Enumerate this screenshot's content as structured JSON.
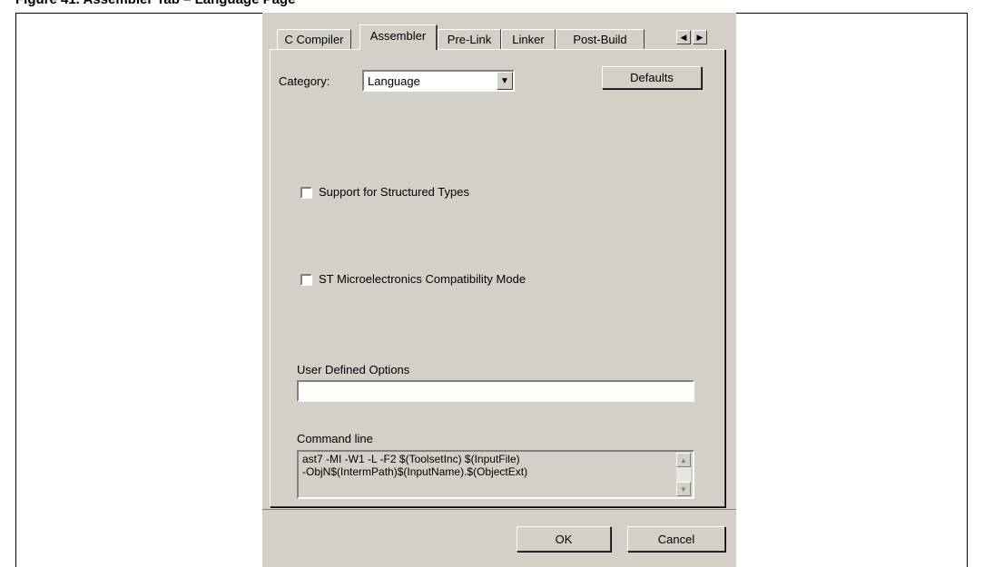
{
  "page": {
    "heading_fragment": "Figure 41. Assembler Tab – Language Page"
  },
  "tabs": [
    {
      "label": "C Compiler",
      "active": false
    },
    {
      "label": "Assembler",
      "active": true
    },
    {
      "label": "Pre-Link",
      "active": false
    },
    {
      "label": "Linker",
      "active": false
    },
    {
      "label": "Post-Build",
      "active": false
    }
  ],
  "tab_scroll": {
    "left_icon": "arrow-left-icon",
    "right_icon": "arrow-right-icon"
  },
  "category": {
    "label": "Category:",
    "selected": "Language"
  },
  "defaults_button": "Defaults",
  "options": {
    "structured_types": {
      "label": "Support for Structured Types",
      "checked": false
    },
    "st_compat": {
      "label": "ST Microelectronics Compatibility Mode",
      "checked": false
    }
  },
  "user_options": {
    "label": "User Defined Options",
    "value": ""
  },
  "command_line": {
    "label": "Command line",
    "line1": "ast7  -MI -W1 -L -F2 $(ToolsetInc) $(InputFile)",
    "line2": "-ObjN$(IntermPath)$(InputName).$(ObjectExt)"
  },
  "footer": {
    "ok": "OK",
    "cancel": "Cancel"
  }
}
